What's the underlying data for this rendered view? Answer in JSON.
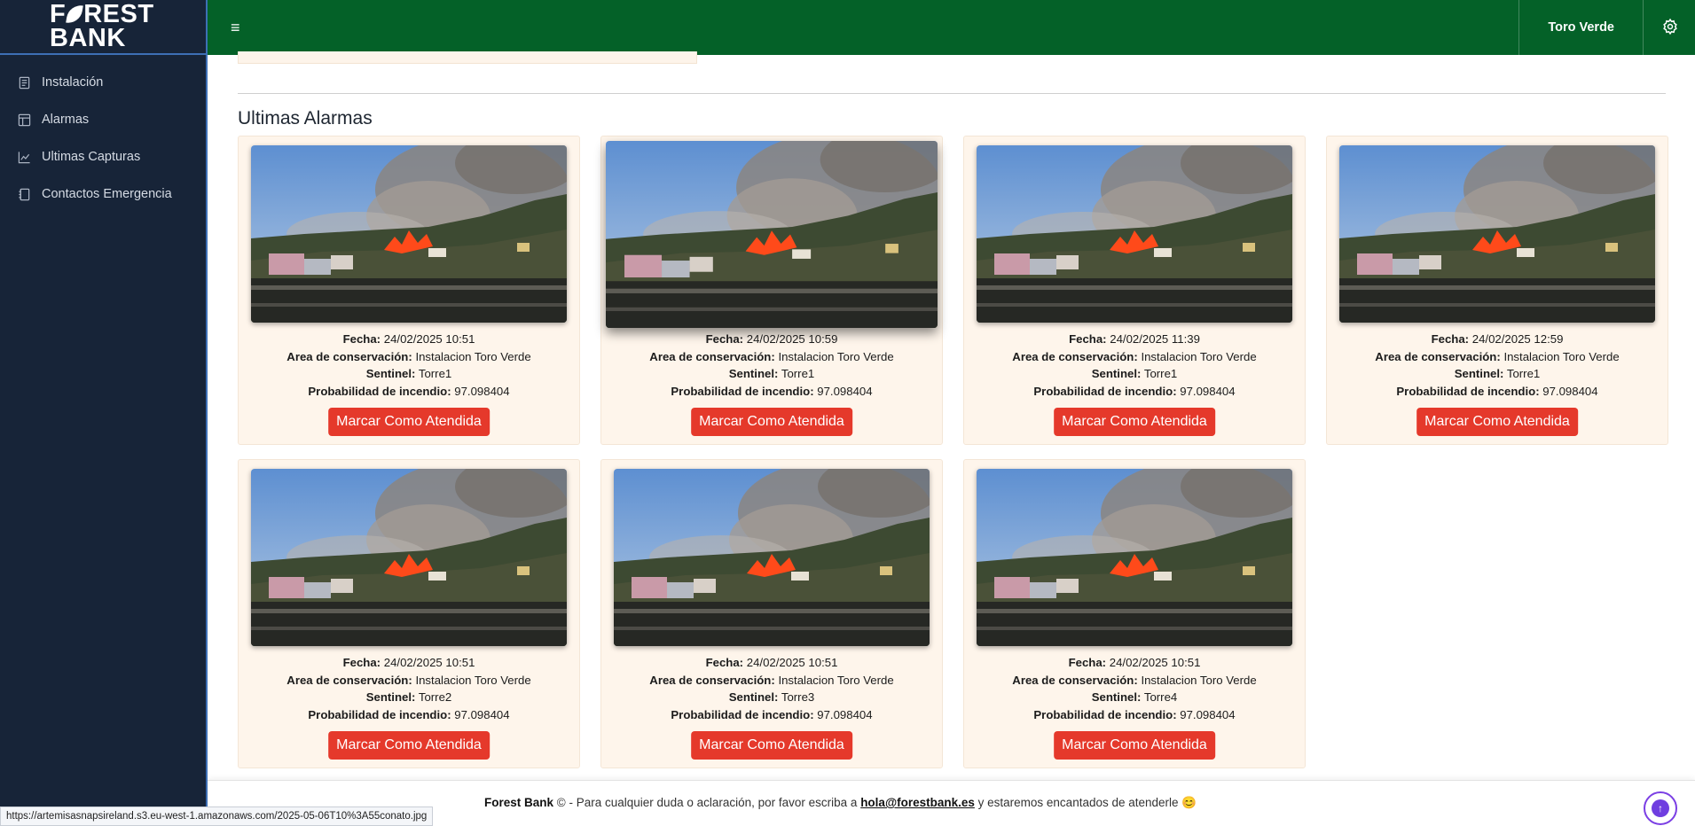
{
  "brand": {
    "logo_line1_a": "F",
    "logo_line1_b": "REST",
    "logo_line2": "BANK"
  },
  "sidebar": {
    "items": [
      {
        "label": "Instalación",
        "icon": "document-icon"
      },
      {
        "label": "Alarmas",
        "icon": "layout-icon"
      },
      {
        "label": "Ultimas Capturas",
        "icon": "chart-icon"
      },
      {
        "label": "Contactos Emergencia",
        "icon": "book-icon"
      }
    ]
  },
  "topbar": {
    "menu_icon": "hamburger-icon",
    "user_name": "Toro Verde",
    "settings_icon": "gear-icon"
  },
  "main": {
    "section_title": "Ultimas Alarmas",
    "labels": {
      "fecha": "Fecha:",
      "area": "Area de conservación:",
      "sentinel": "Sentinel:",
      "probabilidad": "Probabilidad de incendio:"
    },
    "alarms": [
      {
        "fecha": "24/02/2025 10:51",
        "area": "Instalacion Toro Verde",
        "sentinel": "Torre1",
        "probabilidad": "97.098404",
        "button": "Marcar Como Atendida"
      },
      {
        "fecha": "24/02/2025 10:59",
        "area": "Instalacion Toro Verde",
        "sentinel": "Torre1",
        "probabilidad": "97.098404",
        "button": "Marcar Como Atendida"
      },
      {
        "fecha": "24/02/2025 11:39",
        "area": "Instalacion Toro Verde",
        "sentinel": "Torre1",
        "probabilidad": "97.098404",
        "button": "Marcar Como Atendida"
      },
      {
        "fecha": "24/02/2025 12:59",
        "area": "Instalacion Toro Verde",
        "sentinel": "Torre1",
        "probabilidad": "97.098404",
        "button": "Marcar Como Atendida"
      },
      {
        "fecha": "24/02/2025 10:51",
        "area": "Instalacion Toro Verde",
        "sentinel": "Torre2",
        "probabilidad": "97.098404",
        "button": "Marcar Como Atendida"
      },
      {
        "fecha": "24/02/2025 10:51",
        "area": "Instalacion Toro Verde",
        "sentinel": "Torre3",
        "probabilidad": "97.098404",
        "button": "Marcar Como Atendida"
      },
      {
        "fecha": "24/02/2025 10:51",
        "area": "Instalacion Toro Verde",
        "sentinel": "Torre4",
        "probabilidad": "97.098404",
        "button": "Marcar Como Atendida"
      }
    ]
  },
  "footer": {
    "brand": "Forest Bank",
    "copyright": "©",
    "text_before": " - Para cualquier duda o aclaración, por favor escriba a ",
    "email": "hola@forestbank.es",
    "text_after": " y estaremos encantados de atenderle 😊",
    "scroll_icon": "arrow-up-icon"
  },
  "status_bar": {
    "url": "https://artemisasnapsireland.s3.eu-west-1.amazonaws.com/2025-05-06T10%3A55conato.jpg"
  },
  "colors": {
    "sidebar_bg": "#172438",
    "topbar_bg": "#046128",
    "card_bg": "#fef5eb",
    "button_bg": "#e5392b",
    "accent_purple": "#6f3ee0"
  }
}
